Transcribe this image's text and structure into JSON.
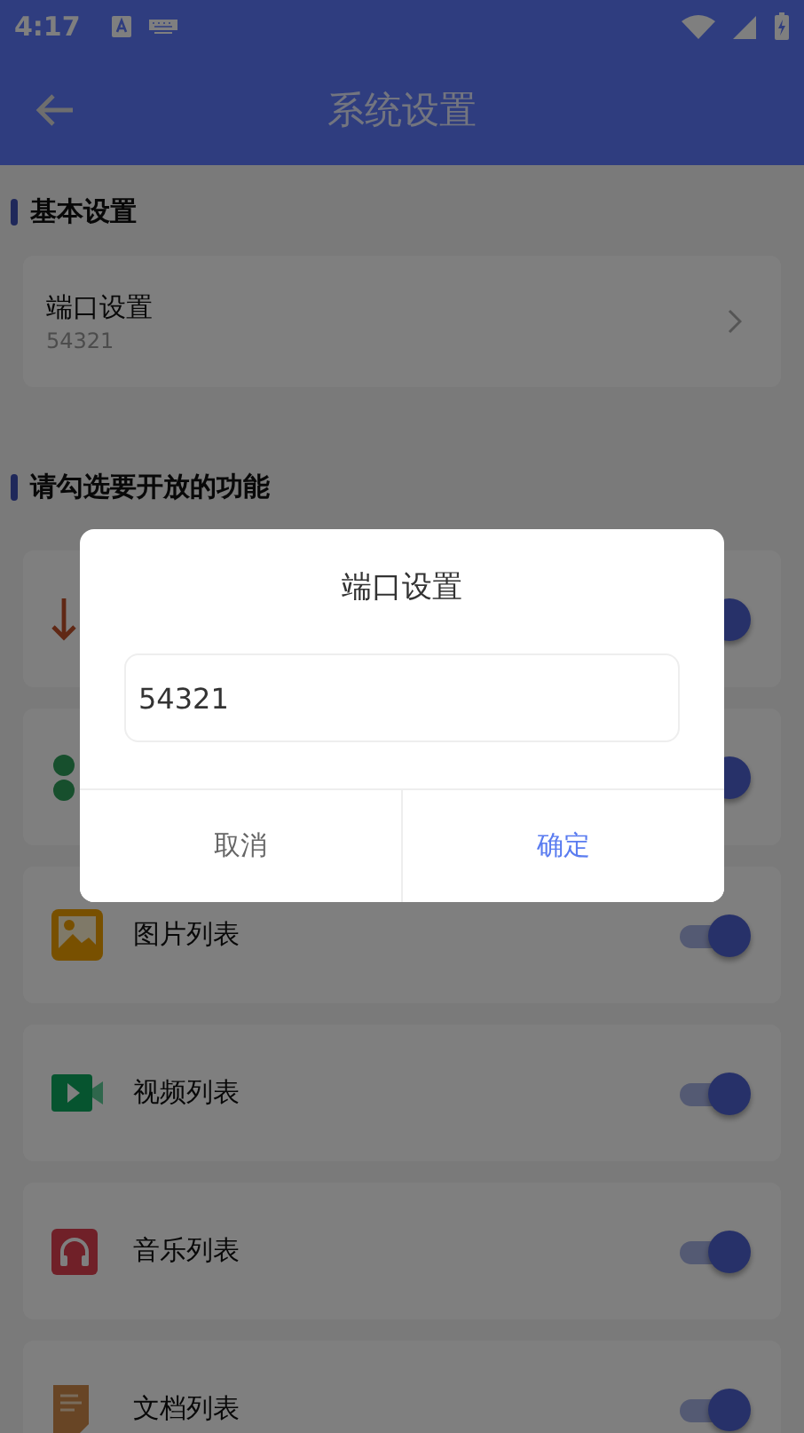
{
  "status_bar": {
    "time": "4:17"
  },
  "app_bar": {
    "title": "系统设置"
  },
  "basic_section": {
    "title": "基本设置",
    "items": [
      {
        "label": "端口设置",
        "value": "54321"
      }
    ]
  },
  "features_section": {
    "title": "请勾选要开放的功能",
    "items": [
      {
        "kind": "download",
        "on": true
      },
      {
        "kind": "dots",
        "on": true
      },
      {
        "kind": "image",
        "label": "图片列表",
        "on": true
      },
      {
        "kind": "video",
        "label": "视频列表",
        "on": true
      },
      {
        "kind": "music",
        "label": "音乐列表",
        "on": true
      },
      {
        "kind": "document",
        "label": "文档列表",
        "on": true
      }
    ]
  },
  "dialog": {
    "title": "端口设置",
    "input": {
      "value": "54321"
    },
    "buttons": [
      {
        "label": "取消",
        "kind": "cancel"
      },
      {
        "label": "确定",
        "kind": "confirm"
      }
    ]
  }
}
